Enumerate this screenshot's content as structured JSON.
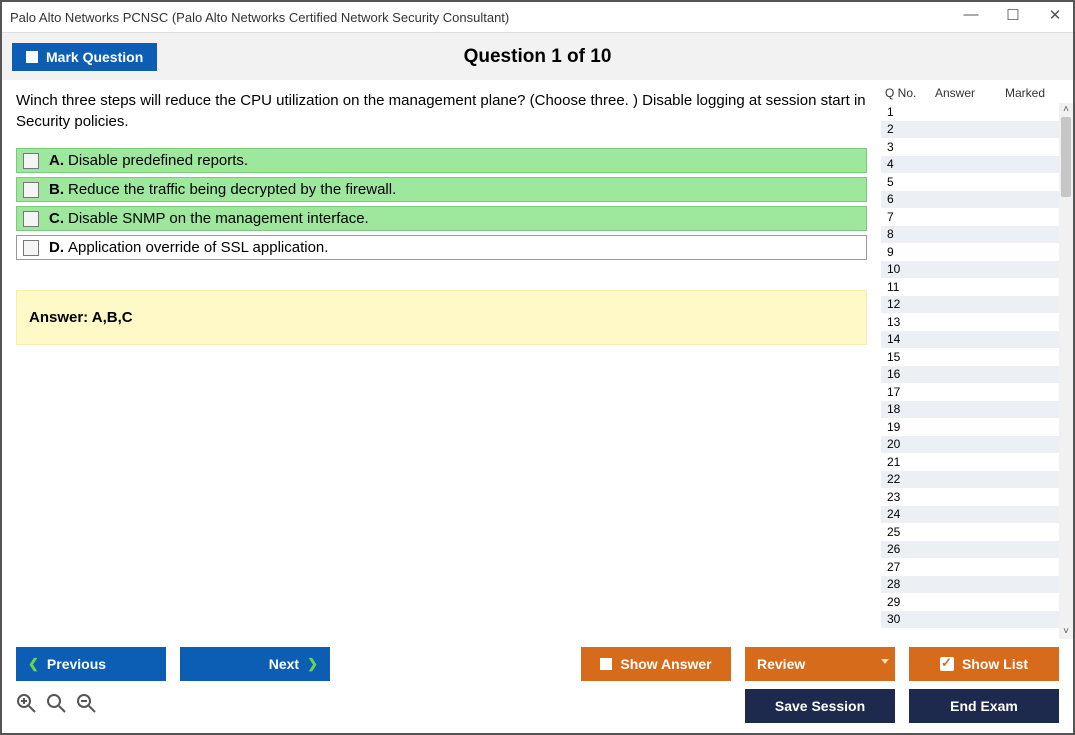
{
  "title": "Palo Alto Networks PCNSC (Palo Alto Networks Certified Network Security Consultant)",
  "header": {
    "mark_question": "Mark Question",
    "question_header": "Question 1 of 10"
  },
  "question": {
    "text": "Winch three steps will reduce the CPU utilization on the management plane? (Choose three. ) Disable logging at session start in Security policies.",
    "options": [
      {
        "key": "A.",
        "text": "Disable predefined reports.",
        "correct": true
      },
      {
        "key": "B.",
        "text": "Reduce the traffic being decrypted by the firewall.",
        "correct": true
      },
      {
        "key": "C.",
        "text": "Disable SNMP on the management interface.",
        "correct": true
      },
      {
        "key": "D.",
        "text": "Application override of SSL application.",
        "correct": false
      }
    ],
    "answer_label": "Answer: A,B,C"
  },
  "sidebar": {
    "cols": {
      "qno": "Q No.",
      "answer": "Answer",
      "marked": "Marked"
    },
    "rows": [
      1,
      2,
      3,
      4,
      5,
      6,
      7,
      8,
      9,
      10,
      11,
      12,
      13,
      14,
      15,
      16,
      17,
      18,
      19,
      20,
      21,
      22,
      23,
      24,
      25,
      26,
      27,
      28,
      29,
      30
    ]
  },
  "footer": {
    "previous": "Previous",
    "next": "Next",
    "show_answer": "Show Answer",
    "review": "Review",
    "show_list": "Show List",
    "save_session": "Save Session",
    "end_exam": "End Exam"
  }
}
